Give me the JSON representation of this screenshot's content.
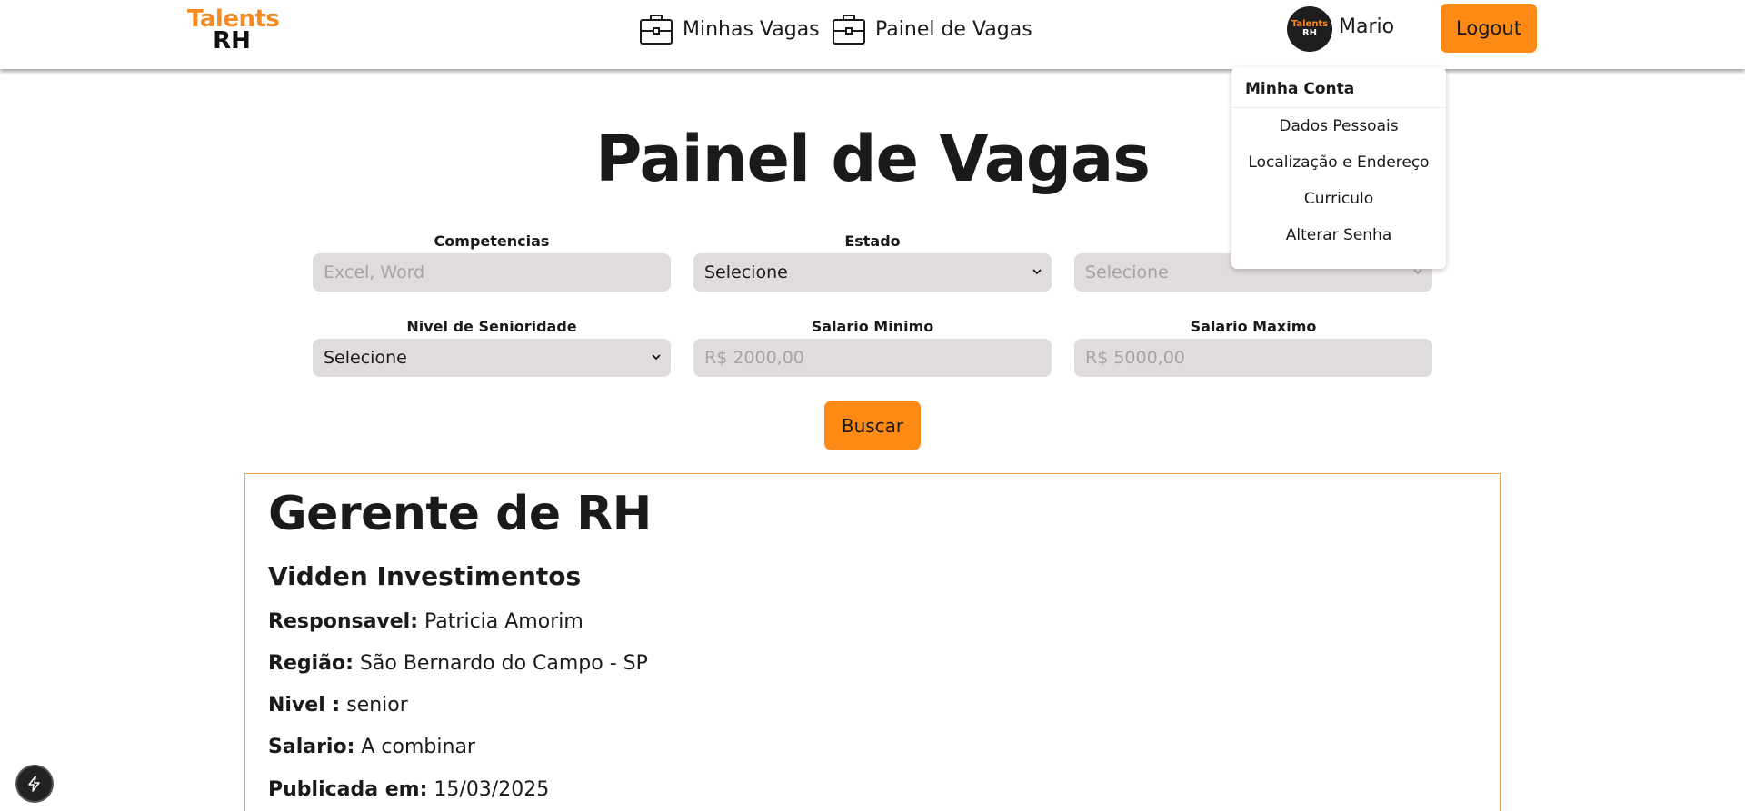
{
  "header": {
    "logo_line1": "Talents",
    "logo_line2": "RH",
    "nav": [
      {
        "label": "Minhas Vagas",
        "icon": "briefcase-icon"
      },
      {
        "label": "Painel de Vagas",
        "icon": "briefcase-icon"
      }
    ],
    "avatar_line1": "Talents",
    "avatar_line2": "RH",
    "username": "Mario",
    "logout_label": "Logout"
  },
  "account_menu": {
    "title": "Minha Conta",
    "items": [
      "Dados Pessoais",
      "Localização e Endereço",
      "Curriculo",
      "Alterar Senha"
    ]
  },
  "page_title": "Painel de Vagas",
  "filters": {
    "competencias": {
      "label": "Competencias",
      "placeholder": "Excel, Word"
    },
    "estado": {
      "label": "Estado",
      "value": "Selecione"
    },
    "cidade": {
      "label": "C",
      "value": "Selecione"
    },
    "nivel": {
      "label": "Nivel de Senioridade",
      "value": "Selecione"
    },
    "salario_min": {
      "label": "Salario Minimo",
      "placeholder": "R$ 2000,00"
    },
    "salario_max": {
      "label": "Salario Maximo",
      "placeholder": "R$ 5000,00"
    },
    "search_label": "Buscar"
  },
  "job": {
    "title": "Gerente de RH",
    "company": "Vidden Investimentos",
    "fields": [
      {
        "label": "Responsavel:",
        "value": "Patricia Amorim"
      },
      {
        "label": "Região:",
        "value": "São Bernardo do Campo - SP"
      },
      {
        "label": "Nivel :",
        "value": "senior"
      },
      {
        "label": "Salario:",
        "value": "A combinar"
      },
      {
        "label": "Publicada em:",
        "value": "15/03/2025"
      }
    ]
  },
  "colors": {
    "accent": "#fd8a14",
    "input_bg": "#e1dcdc",
    "card_border": "#f4a04b"
  }
}
